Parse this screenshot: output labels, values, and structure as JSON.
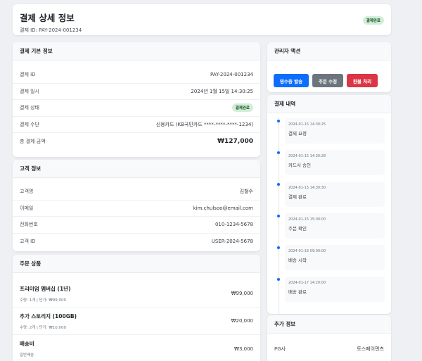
{
  "header": {
    "title": "결제 상세 정보",
    "subtitle": "결제 ID: PAY-2024-001234",
    "status_badge": "결제완료"
  },
  "basic_info": {
    "title": "결제 기본 정보",
    "rows": [
      {
        "label": "결제 ID",
        "value": "PAY-2024-001234"
      },
      {
        "label": "결제 일시",
        "value": "2024년 1월 15일 14:30:25"
      },
      {
        "label": "결제 상태",
        "value": "결제완료"
      },
      {
        "label": "결제 수단",
        "value": "신용카드 (KB국민카드 ****-****-****-1234)"
      },
      {
        "label": "총 결제 금액",
        "value": "₩127,000"
      }
    ]
  },
  "customer": {
    "title": "고객 정보",
    "rows": [
      {
        "label": "고객명",
        "value": "김철수"
      },
      {
        "label": "이메일",
        "value": "kim.chulsoo@email.com"
      },
      {
        "label": "전화번호",
        "value": "010-1234-5678"
      },
      {
        "label": "고객 ID",
        "value": "USER-2024-5678"
      }
    ]
  },
  "products": {
    "title": "주문 상품",
    "items": [
      {
        "name": "프리미엄 멤버십 (1년)",
        "detail": "수량: 1개 | 단가: ₩99,000",
        "price": "₩99,000"
      },
      {
        "name": "추가 스토리지 (100GB)",
        "detail": "수량: 2개 | 단가: ₩10,000",
        "price": "₩20,000"
      },
      {
        "name": "배송비",
        "detail": "일반배송",
        "price": "₩3,000"
      }
    ]
  },
  "admin": {
    "title": "관리자 액션",
    "receipt_label": "영수증 발송",
    "edit_label": "주문 수정",
    "refund_label": "환불 처리"
  },
  "history": {
    "title": "결제 내역",
    "items": [
      {
        "time": "2024-01-15 14:30:25",
        "text": "결제 요청"
      },
      {
        "time": "2024-01-15 14:30:28",
        "text": "카드사 승인"
      },
      {
        "time": "2024-01-15 14:30:30",
        "text": "결제 완료"
      },
      {
        "time": "2024-01-15 15:00:00",
        "text": "주문 확인"
      },
      {
        "time": "2024-01-16 09:00:00",
        "text": "배송 시작"
      },
      {
        "time": "2024-01-17 14:20:00",
        "text": "배송 완료"
      }
    ]
  },
  "extra": {
    "title": "추가 정보",
    "rows": [
      {
        "label": "PG사",
        "value": "토스페이먼츠"
      }
    ]
  },
  "colors": {
    "primary": "#0d6efd",
    "secondary": "#6c757d",
    "danger": "#dc3545",
    "success_bg": "#d4edda"
  }
}
